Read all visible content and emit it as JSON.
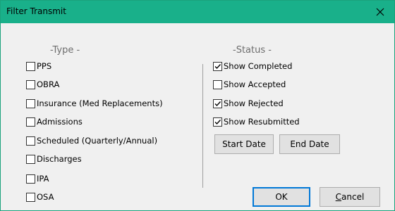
{
  "window": {
    "title": "Filter Transmit"
  },
  "type_section": {
    "heading": "-Type -",
    "items": [
      {
        "label": "PPS",
        "checked": false
      },
      {
        "label": "OBRA",
        "checked": false
      },
      {
        "label": "Insurance (Med Replacements)",
        "checked": false
      },
      {
        "label": "Admissions",
        "checked": false
      },
      {
        "label": "Scheduled (Quarterly/Annual)",
        "checked": false
      },
      {
        "label": "Discharges",
        "checked": false
      },
      {
        "label": "IPA",
        "checked": false
      },
      {
        "label": "OSA",
        "checked": false
      }
    ]
  },
  "status_section": {
    "heading": "-Status -",
    "items": [
      {
        "label": "Show Completed",
        "checked": true
      },
      {
        "label": "Show Accepted",
        "checked": false
      },
      {
        "label": "Show Rejected",
        "checked": true
      },
      {
        "label": "Show Resubmitted",
        "checked": true
      }
    ]
  },
  "buttons": {
    "start_date": "Start Date",
    "end_date": "End Date",
    "ok": "OK",
    "cancel_accel": "C",
    "cancel_rest": "ancel"
  },
  "colors": {
    "titlebar": "#19b08a",
    "dialog_bg": "#f0f0f0",
    "button_bg": "#e1e1e1",
    "ok_border": "#0078d7"
  }
}
